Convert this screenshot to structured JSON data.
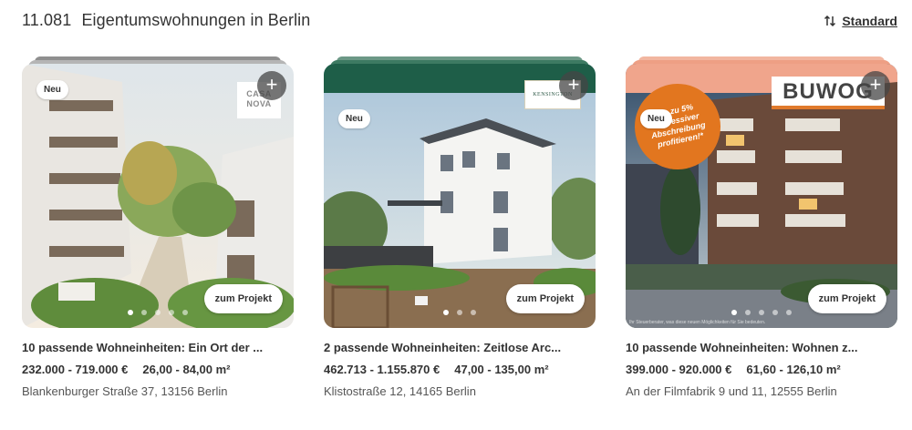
{
  "header": {
    "count": "11.081",
    "title": "Eigentumswohnungen in Berlin",
    "sort_label": "Standard",
    "sort_icon": "sort-arrows-icon"
  },
  "cards": [
    {
      "badge": "Neu",
      "plus": "+",
      "button": "zum Projekt",
      "logo": "CASA\nNOVA",
      "headline": "10 passende Wohneinheiten: Ein Ort der ...",
      "price": "232.000 - 719.000 €",
      "area": "26,00 - 84,00 m²",
      "address": "Blankenburger Straße 37, 13156 Berlin",
      "images_total": 5,
      "image_active": 1
    },
    {
      "badge": "Neu",
      "plus": "+",
      "button": "zum Projekt",
      "logo": "KENSINGTON",
      "headline": "2 passende Wohneinheiten: Zeitlose Arc...",
      "price": "462.713 - 1.155.870 €",
      "area": "47,00 - 135,00 m²",
      "address": "Klistostraße 12, 14165 Berlin",
      "images_total": 3,
      "image_active": 1
    },
    {
      "badge": "Neu",
      "plus": "+",
      "button": "zum Projekt",
      "logo": "BUWOG",
      "promo": "Bis zu 5% degressiver Abschreibung profitieren!*",
      "disclaimer": "Ihr Steuerberater, was diese neuen Möglichkeiten für Sie bedeuten.",
      "headline": "10 passende Wohneinheiten: Wohnen z...",
      "price": "399.000 - 920.000 €",
      "area": "61,60 - 126,10 m²",
      "address": "An der Filmfabrik 9 und 11, 12555 Berlin",
      "images_total": 5,
      "image_active": 1
    }
  ],
  "colors": {
    "card1_stack": "#9e9e9e",
    "card2_banner": "#1e5e48",
    "card3_banner": "#f0a58c",
    "buwog_orange": "#e2761f"
  }
}
